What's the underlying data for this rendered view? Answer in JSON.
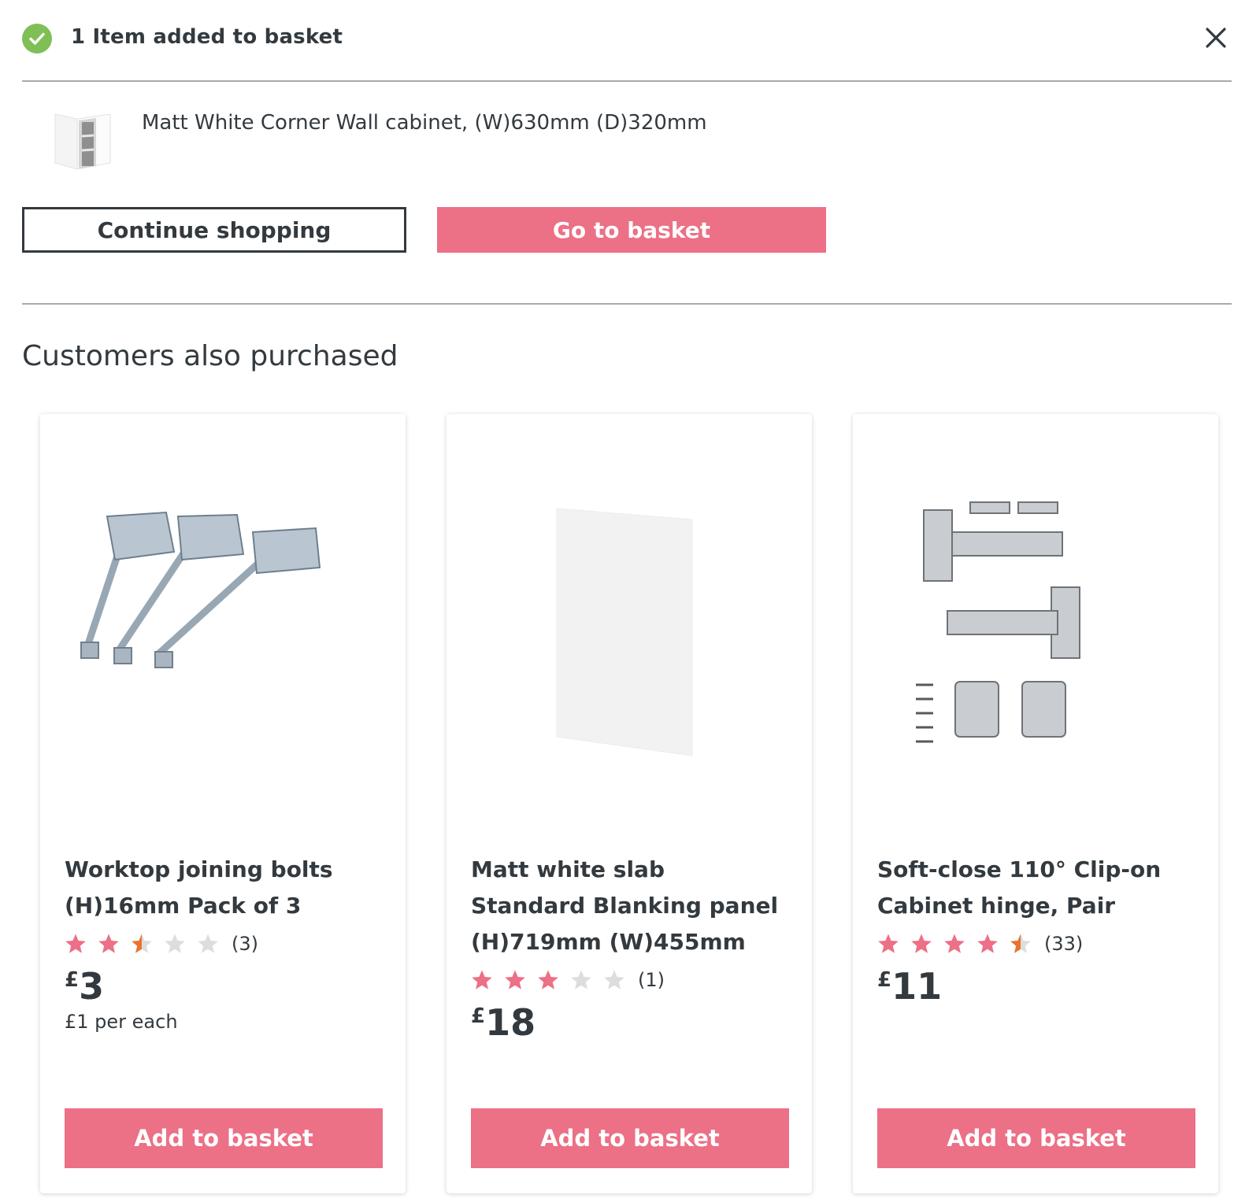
{
  "notification": {
    "title": "1 Item added to basket"
  },
  "added_item": {
    "name": "Matt White Corner Wall cabinet, (W)630mm (D)320mm"
  },
  "actions": {
    "continue_label": "Continue shopping",
    "basket_label": "Go to basket"
  },
  "recommendations": {
    "heading": "Customers also purchased",
    "products": [
      {
        "title": "Worktop joining bolts (H)16mm Pack of 3",
        "rating": 2.5,
        "rating_count": "(3)",
        "currency": "£",
        "price": "3",
        "unit_price": "£1 per each",
        "button": "Add to basket"
      },
      {
        "title": "Matt white slab Standard Blanking panel (H)719mm (W)455mm",
        "rating": 3,
        "rating_count": "(1)",
        "currency": "£",
        "price": "18",
        "unit_price": "",
        "button": "Add to basket"
      },
      {
        "title": "Soft-close 110° Clip-on Cabinet hinge, Pair",
        "rating": 4.5,
        "rating_count": "(33)",
        "currency": "£",
        "price": "11",
        "unit_price": "",
        "button": "Add to basket"
      }
    ]
  },
  "colors": {
    "accent": "#ec7086",
    "success": "#7fbf55",
    "star_filled": "#ec7086",
    "star_half": "#e9742b",
    "star_empty": "#dddddd",
    "text": "#333a3f"
  },
  "icons": {
    "success": "check-circle-icon",
    "close": "close-icon",
    "star": "star-icon"
  }
}
